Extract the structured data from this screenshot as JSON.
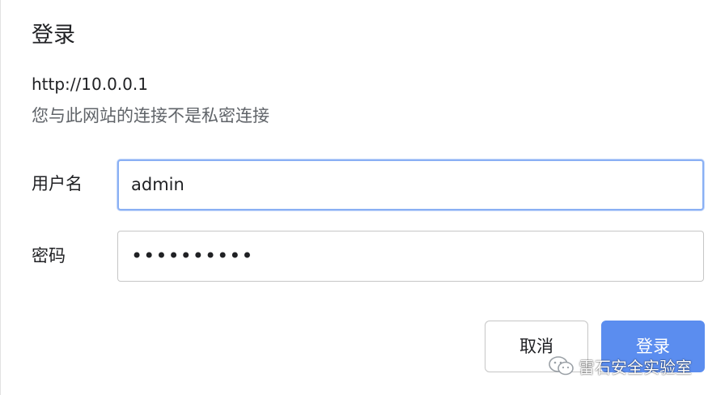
{
  "dialog": {
    "title": "登录",
    "url": "http://10.0.0.1",
    "warning": "您与此网站的连接不是私密连接"
  },
  "form": {
    "username_label": "用户名",
    "username_value": "admin",
    "password_label": "密码",
    "password_value": "••••••••••"
  },
  "buttons": {
    "cancel_label": "取消",
    "login_label": "登录"
  },
  "watermark": {
    "text": "雷石安全实验室",
    "icon": "wechat-icon"
  },
  "colors": {
    "accent": "#5b8def",
    "focus_border": "#8ab0f4",
    "secondary_text": "#5f6368"
  }
}
